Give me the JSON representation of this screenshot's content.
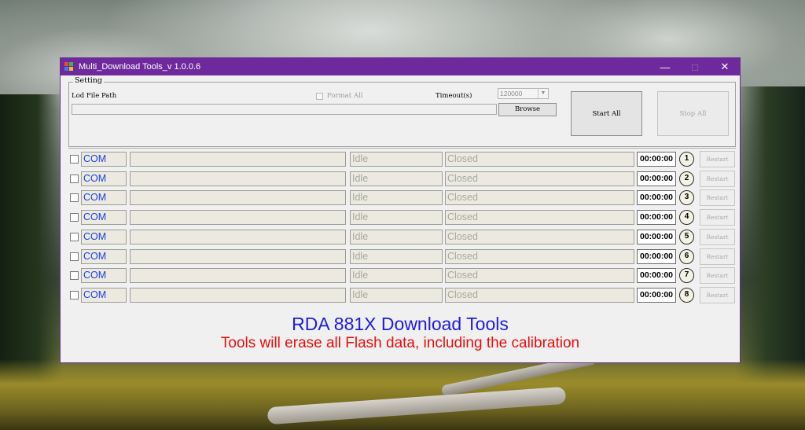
{
  "window": {
    "title": "Multi_Download Tools_v 1.0.0.6",
    "controls": {
      "minimize": "—",
      "maximize": "□",
      "close": "✕"
    },
    "accent_color": "#6e2a9c"
  },
  "setting": {
    "group_label": "Setting",
    "lod_label": "Lod File Path",
    "lod_path_value": "",
    "format_all_label": "Format All",
    "timeout_label": "Timeout(s)",
    "timeout_value": "120000",
    "browse_label": "Browse",
    "start_all_label": "Start All",
    "stop_all_label": "Stop All"
  },
  "ports": [
    {
      "com": "COM",
      "progress": "",
      "state": "Idle",
      "status": "Closed",
      "time": "00:00:00",
      "number": "1",
      "restart": "Restart"
    },
    {
      "com": "COM",
      "progress": "",
      "state": "Idle",
      "status": "Closed",
      "time": "00:00:00",
      "number": "2",
      "restart": "Restart"
    },
    {
      "com": "COM",
      "progress": "",
      "state": "Idle",
      "status": "Closed",
      "time": "00:00:00",
      "number": "3",
      "restart": "Restart"
    },
    {
      "com": "COM",
      "progress": "",
      "state": "Idle",
      "status": "Closed",
      "time": "00:00:00",
      "number": "4",
      "restart": "Restart"
    },
    {
      "com": "COM",
      "progress": "",
      "state": "Idle",
      "status": "Closed",
      "time": "00:00:00",
      "number": "5",
      "restart": "Restart"
    },
    {
      "com": "COM",
      "progress": "",
      "state": "Idle",
      "status": "Closed",
      "time": "00:00:00",
      "number": "6",
      "restart": "Restart"
    },
    {
      "com": "COM",
      "progress": "",
      "state": "Idle",
      "status": "Closed",
      "time": "00:00:00",
      "number": "7",
      "restart": "Restart"
    },
    {
      "com": "COM",
      "progress": "",
      "state": "Idle",
      "status": "Closed",
      "time": "00:00:00",
      "number": "8",
      "restart": "Restart"
    }
  ],
  "footer": {
    "title": "RDA 881X Download Tools",
    "warning": "Tools will erase all Flash data, including the calibration",
    "title_color": "#1d1cde",
    "warning_color": "#e5100f"
  }
}
